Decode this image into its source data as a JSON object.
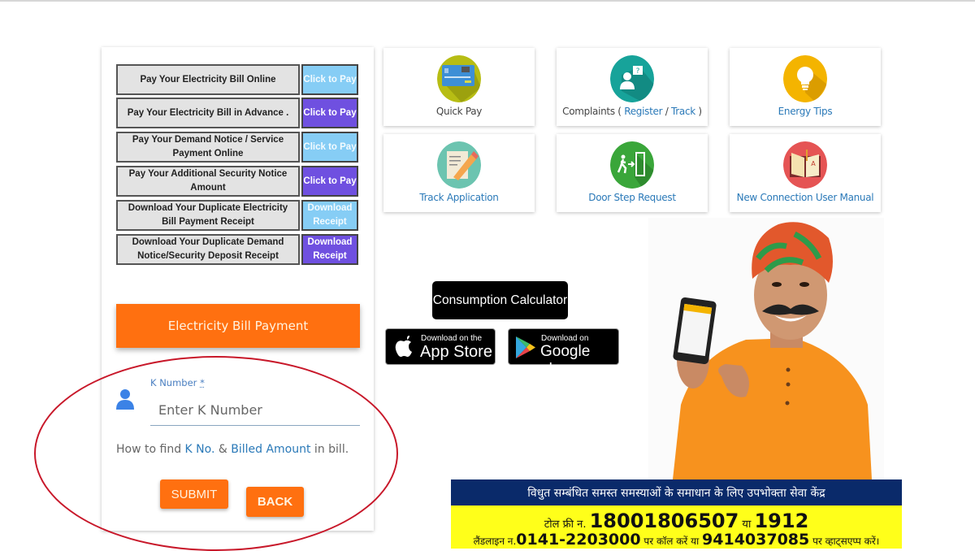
{
  "payment_options": [
    {
      "label": "Pay Your Electricity Bill Online",
      "button": "Click to Pay",
      "style": "light"
    },
    {
      "label": "Pay Your Electricity Bill in Advance .",
      "button": "Click to Pay",
      "style": "purple"
    },
    {
      "label": "Pay Your Demand Notice / Service Payment Online",
      "button": "Click to Pay",
      "style": "light"
    },
    {
      "label": "Pay Your Additional Security Notice Amount",
      "button": "Click to Pay",
      "style": "purple"
    },
    {
      "label": "Download Your Duplicate Electricity Bill Payment Receipt",
      "button": "Download Receipt",
      "style": "light"
    },
    {
      "label": "Download Your Duplicate Demand Notice/Security Deposit Receipt",
      "button": "Download Receipt",
      "style": "purple"
    }
  ],
  "bill_form": {
    "header_button": "Electricity Bill Payment",
    "k_number_label": "K Number",
    "k_number_required": "*",
    "k_number_placeholder": "Enter K Number",
    "k_number_value": "",
    "help_prefix": "How to find ",
    "help_link1": "K No.",
    "help_mid": " & ",
    "help_link2": "Billed Amount",
    "help_suffix": " in bill.",
    "submit_label": "SUBMIT",
    "back_label": "BACK"
  },
  "tiles": [
    {
      "label": "Quick Pay",
      "icon": "credit-card-icon"
    },
    {
      "label_prefix": "Complaints ( ",
      "link1": "Register",
      "sep": " / ",
      "link2": "Track",
      "label_suffix": " )",
      "icon": "complaint-person-icon"
    },
    {
      "label": "Energy Tips",
      "icon": "lightbulb-icon"
    },
    {
      "label": "Track Application",
      "icon": "pencil-document-icon"
    },
    {
      "label": "Door Step Request",
      "icon": "door-exit-icon"
    },
    {
      "label": "New Connection User Manual",
      "icon": "book-manual-icon"
    }
  ],
  "consumption_calculator": "Consumption Calculator",
  "app_store": {
    "small": "Download on the",
    "big": "App Store"
  },
  "google_play": {
    "small": "Download on",
    "big": "Google play"
  },
  "helpline_banner": {
    "title": "विधुत सम्बंधित समस्त समस्याओं के समाधान के लिए उपभोक्ता सेवा केंद्र",
    "tollfree_prefix": "टोल फ्री न. ",
    "tollfree_number": "18001806507",
    "tollfree_or": " या ",
    "tollfree_short": "1912",
    "landline_prefix": "लैंडलाइन न.",
    "landline_number": "0141-2203000",
    "landline_mid": " पर कॉल करें या ",
    "whatsapp_number": "9414037085",
    "whatsapp_suffix": " पर व्हाट्सएप्प करें।"
  },
  "colors": {
    "accent_orange": "#ff7010",
    "button_light_blue": "#86cdf5",
    "button_purple": "#6f50e0",
    "link_blue": "#2a79b8",
    "annotation_red": "#c8182a",
    "banner_navy": "#0a2a6a",
    "banner_yellow": "#ffff1a"
  }
}
